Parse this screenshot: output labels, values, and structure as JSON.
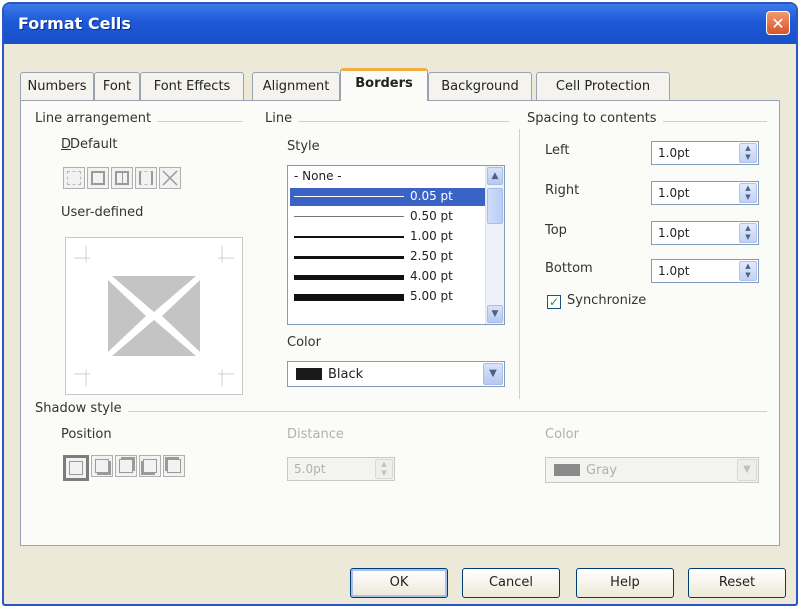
{
  "window": {
    "title": "Format Cells",
    "close_glyph": "✕"
  },
  "tabs": [
    {
      "label": "Numbers"
    },
    {
      "label": "Font"
    },
    {
      "label": "Font Effects"
    },
    {
      "label": "Alignment"
    },
    {
      "label": "Borders",
      "active": true
    },
    {
      "label": "Background"
    },
    {
      "label": "Cell Protection"
    }
  ],
  "line_arrangement": {
    "heading": "Line arrangement",
    "default_label": "Default",
    "default_icons": [
      "no-borders",
      "outer-border",
      "outer-and-vertical",
      "left-right",
      "diagonal"
    ],
    "user_defined_label": "User-defined"
  },
  "line": {
    "heading": "Line",
    "style_label": "Style",
    "styles": [
      {
        "label": "- None -"
      },
      {
        "label": "0.05 pt",
        "selected": true
      },
      {
        "label": "0.50 pt"
      },
      {
        "label": "1.00 pt"
      },
      {
        "label": "2.50 pt"
      },
      {
        "label": "4.00 pt"
      },
      {
        "label": "5.00 pt"
      }
    ],
    "color_label": "Color",
    "color_value": "Black",
    "color_hex": "#1a1a1a"
  },
  "spacing": {
    "heading": "Spacing to contents",
    "left_label": "Left",
    "left_value": "1.0pt",
    "right_label": "Right",
    "right_value": "1.0pt",
    "top_label": "Top",
    "top_value": "1.0pt",
    "bottom_label": "Bottom",
    "bottom_value": "1.0pt",
    "synchronize_label": "Synchronize",
    "synchronize_checked": true
  },
  "shadow": {
    "heading": "Shadow style",
    "position_label": "Position",
    "distance_label": "Distance",
    "distance_value": "5.0pt",
    "color_label": "Color",
    "color_value": "Gray",
    "color_hex": "#808080"
  },
  "buttons": {
    "ok": "OK",
    "cancel": "Cancel",
    "help": "Help",
    "reset": "Reset"
  }
}
